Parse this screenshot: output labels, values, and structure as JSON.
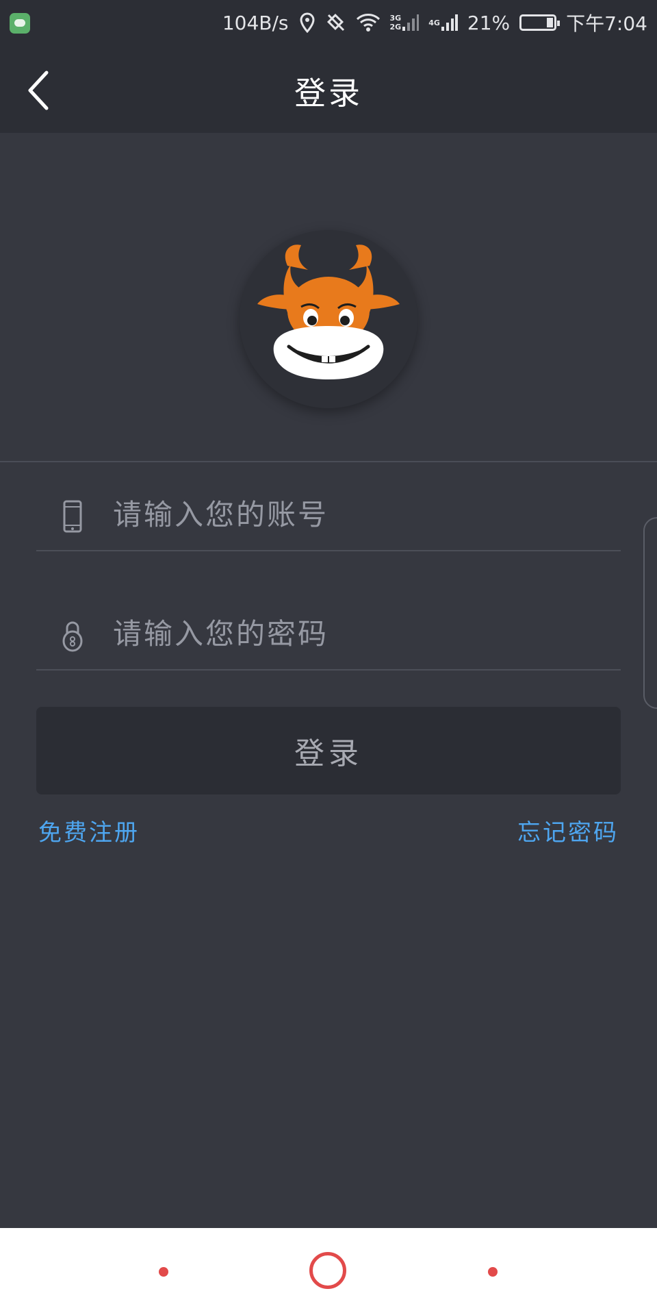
{
  "status_bar": {
    "net_speed": "104B/s",
    "signal_3g": "3G",
    "signal_2g": "2G",
    "signal_4g": "4G",
    "battery_percent": "21%",
    "battery_level": 0.21,
    "time": "下午7:04",
    "icons": [
      "wechat-icon",
      "location-icon",
      "rotation-icon",
      "wifi-icon",
      "signal-icon",
      "battery-icon"
    ]
  },
  "header": {
    "title": "登录",
    "back_icon": "chevron-left-icon"
  },
  "logo": {
    "icon": "cow-mascot-logo",
    "colors": {
      "orange": "#e87a1c",
      "muzzle": "#ffffff",
      "circle": "#2e3037"
    }
  },
  "form": {
    "account": {
      "placeholder": "请输入您的账号",
      "value": "",
      "icon": "phone-icon"
    },
    "password": {
      "placeholder": "请输入您的密码",
      "value": "",
      "icon": "lock-icon"
    },
    "submit_label": "登录"
  },
  "links": {
    "register": "免费注册",
    "forgot_password": "忘记密码"
  },
  "colors": {
    "background": "#363840",
    "bar": "#2c2e35",
    "link": "#4ea6f0",
    "nav_accent": "#e24a4a"
  }
}
